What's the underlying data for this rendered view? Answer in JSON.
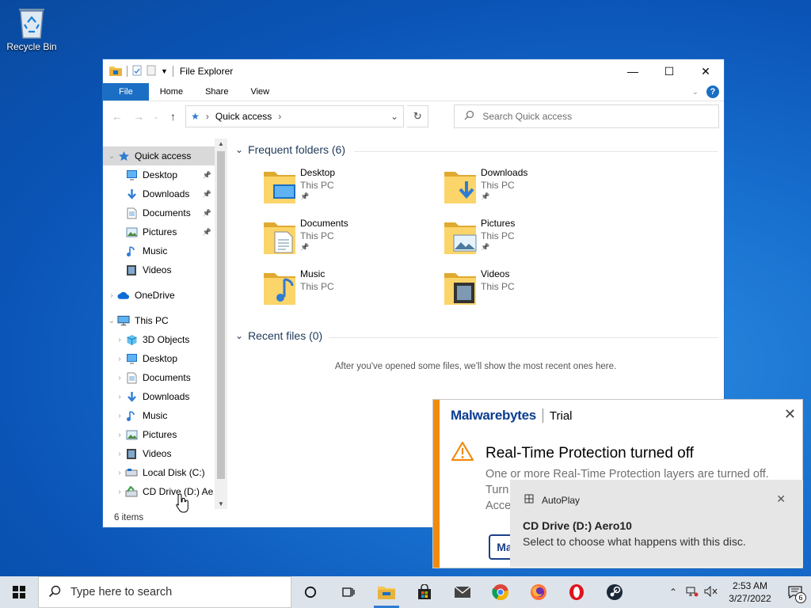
{
  "desktop": {
    "recycle_bin_label": "Recycle Bin"
  },
  "explorer": {
    "title": "File Explorer",
    "ribbon_tabs": [
      "File",
      "Home",
      "Share",
      "View"
    ],
    "address_crumb": "Quick access",
    "search_placeholder": "Search Quick access",
    "status": "6 items",
    "nav": [
      {
        "label": "Quick access",
        "icon": "star-icon",
        "level": 0,
        "pinned": false,
        "selected": true
      },
      {
        "label": "Desktop",
        "icon": "desktop-icon",
        "level": 1,
        "pinned": true
      },
      {
        "label": "Downloads",
        "icon": "download-arrow-icon",
        "level": 1,
        "pinned": true
      },
      {
        "label": "Documents",
        "icon": "document-icon",
        "level": 1,
        "pinned": true
      },
      {
        "label": "Pictures",
        "icon": "picture-icon",
        "level": 1,
        "pinned": true
      },
      {
        "label": "Music",
        "icon": "music-note-icon",
        "level": 1,
        "pinned": false
      },
      {
        "label": "Videos",
        "icon": "film-icon",
        "level": 1,
        "pinned": false
      },
      {
        "label": "OneDrive",
        "icon": "cloud-icon",
        "level": 0,
        "pinned": false
      },
      {
        "label": "This PC",
        "icon": "computer-icon",
        "level": 0,
        "pinned": false
      },
      {
        "label": "3D Objects",
        "icon": "cube-icon",
        "level": 1,
        "pinned": false
      },
      {
        "label": "Desktop",
        "icon": "desktop-icon",
        "level": 1,
        "pinned": false
      },
      {
        "label": "Documents",
        "icon": "document-icon",
        "level": 1,
        "pinned": false
      },
      {
        "label": "Downloads",
        "icon": "download-arrow-icon",
        "level": 1,
        "pinned": false
      },
      {
        "label": "Music",
        "icon": "music-note-icon",
        "level": 1,
        "pinned": false
      },
      {
        "label": "Pictures",
        "icon": "picture-icon",
        "level": 1,
        "pinned": false
      },
      {
        "label": "Videos",
        "icon": "film-icon",
        "level": 1,
        "pinned": false
      },
      {
        "label": "Local Disk (C:)",
        "icon": "drive-icon",
        "level": 1,
        "pinned": false
      },
      {
        "label": "CD Drive (D:) Ae",
        "icon": "cd-drive-icon",
        "level": 1,
        "pinned": false
      }
    ],
    "frequent_header": "Frequent folders (6)",
    "frequent": [
      {
        "name": "Desktop",
        "location": "This PC",
        "pinned": true,
        "overlay": "desktop"
      },
      {
        "name": "Downloads",
        "location": "This PC",
        "pinned": true,
        "overlay": "download"
      },
      {
        "name": "Documents",
        "location": "This PC",
        "pinned": true,
        "overlay": "document"
      },
      {
        "name": "Pictures",
        "location": "This PC",
        "pinned": true,
        "overlay": "picture"
      },
      {
        "name": "Music",
        "location": "This PC",
        "pinned": false,
        "overlay": "music"
      },
      {
        "name": "Videos",
        "location": "This PC",
        "pinned": false,
        "overlay": "film"
      }
    ],
    "recent_header": "Recent files (0)",
    "recent_empty": "After you've opened some files, we'll show the most recent ones here."
  },
  "malwarebytes": {
    "brand": "Malwarebytes",
    "edition": "Trial",
    "headline": "Real-Time Protection turned off",
    "line1": "One or more Real-Time Protection layers are turned off.",
    "line2": "Turn",
    "line3": "Acce",
    "button_label": "Ma",
    "accent_color": "#f18a0e"
  },
  "autoplay": {
    "app": "AutoPlay",
    "title": "CD Drive (D:) Aero10",
    "description": "Select to choose what happens with this disc."
  },
  "taskbar": {
    "search_placeholder": "Type here to search",
    "time": "2:53 AM",
    "date": "3/27/2022",
    "notification_count": "6"
  }
}
